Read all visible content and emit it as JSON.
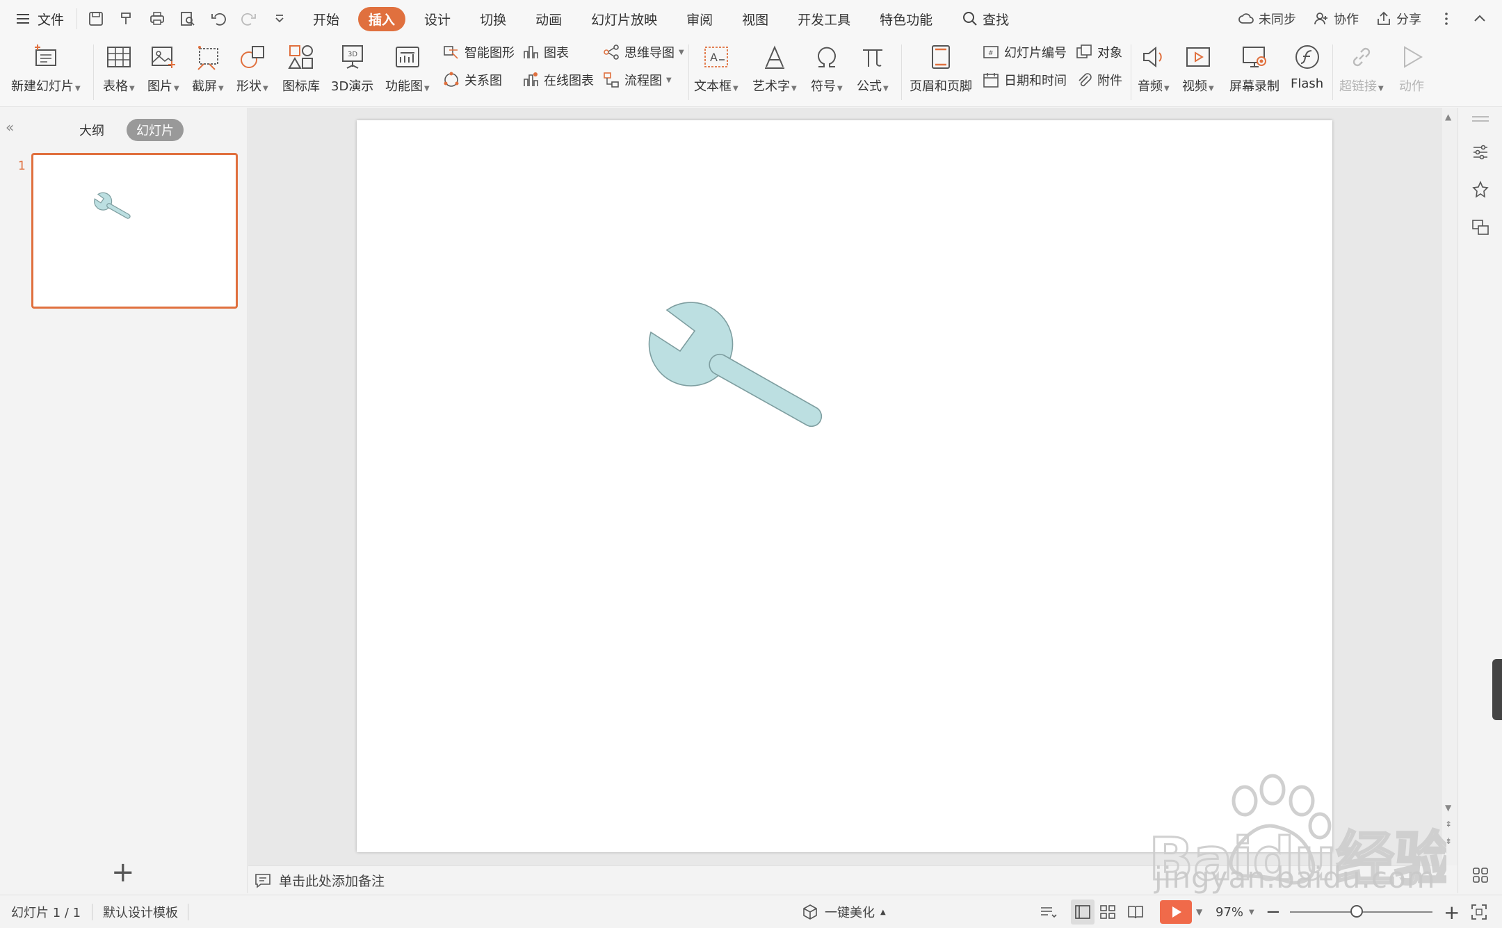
{
  "menubar": {
    "file_label": "文件",
    "tabs": [
      "开始",
      "插入",
      "设计",
      "切换",
      "动画",
      "幻灯片放映",
      "审阅",
      "视图",
      "开发工具",
      "特色功能"
    ],
    "active_tab": "插入",
    "search_label": "查找",
    "sync_label": "未同步",
    "collab_label": "协作",
    "share_label": "分享"
  },
  "ribbon": {
    "new_slide": "新建幻灯片",
    "table": "表格",
    "picture": "图片",
    "screenshot": "截屏",
    "shape": "形状",
    "icon_lib": "图标库",
    "demo3d": "3D演示",
    "func_chart": "功能图",
    "smart_art": "智能图形",
    "chart": "图表",
    "relation": "关系图",
    "online_chart": "在线图表",
    "mindmap": "思维导图",
    "flowchart": "流程图",
    "textbox": "文本框",
    "wordart": "艺术字",
    "symbol": "符号",
    "formula": "公式",
    "header_footer": "页眉和页脚",
    "slide_number": "幻灯片编号",
    "object": "对象",
    "date_time": "日期和时间",
    "attachment": "附件",
    "audio": "音频",
    "video": "视频",
    "screen_record": "屏幕录制",
    "flash": "Flash",
    "hyperlink": "超链接",
    "action": "动作"
  },
  "leftpanel": {
    "outline_tab": "大纲",
    "slides_tab": "幻灯片",
    "slide_number": "1",
    "add_symbol": "+"
  },
  "notes": {
    "placeholder": "单击此处添加备注"
  },
  "statusbar": {
    "slide_info": "幻灯片 1 / 1",
    "template": "默认设计模板",
    "beautify": "一键美化",
    "zoom": "97%"
  },
  "slide": {
    "shape": "wrench-icon",
    "fill": "#bcdfe1",
    "stroke": "#7e9ea0"
  },
  "watermark": {
    "brand": "Baidu经验",
    "url": "jingyan.baidu.com"
  },
  "colors": {
    "accent": "#e0703e",
    "play": "#f06a4a"
  }
}
